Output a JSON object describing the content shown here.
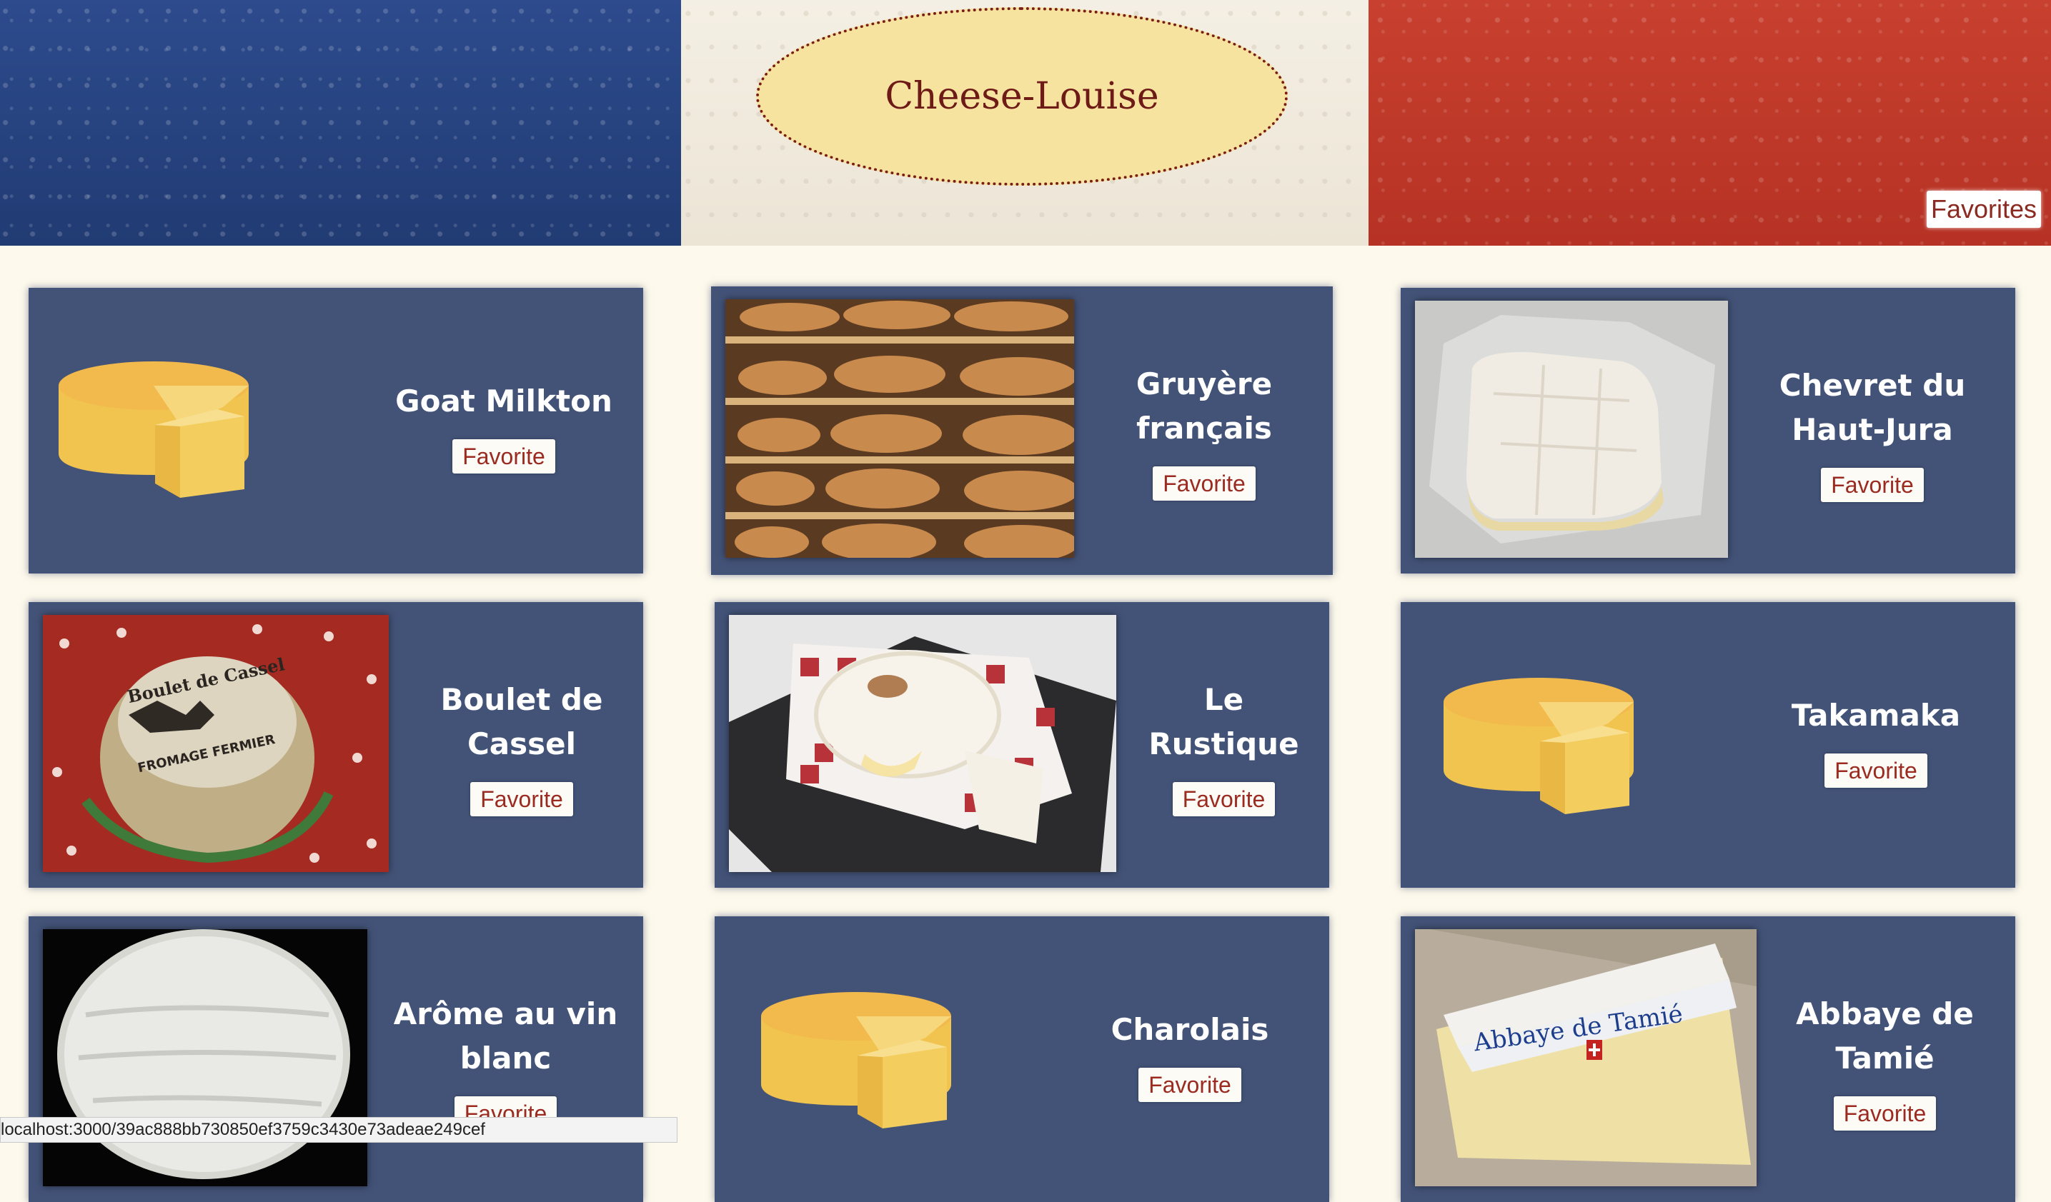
{
  "header": {
    "logo_text": "Cheese-Louise",
    "favorites_link": "Favorites"
  },
  "cards": [
    {
      "name_lines": [
        "Goat Milkton"
      ],
      "button": "Favorite",
      "image": "cheese-wheel-icon"
    },
    {
      "name_lines": [
        "Gruyère",
        "français"
      ],
      "button": "Favorite",
      "image": "gruyere-photo"
    },
    {
      "name_lines": [
        "Chevret du",
        "Haut-Jura"
      ],
      "button": "Favorite",
      "image": "chevret-photo"
    },
    {
      "name_lines": [
        "Boulet de",
        "Cassel"
      ],
      "button": "Favorite",
      "image": "boulet-photo"
    },
    {
      "name_lines": [
        "Le",
        "Rustique"
      ],
      "button": "Favorite",
      "image": "rustique-photo"
    },
    {
      "name_lines": [
        "Takamaka"
      ],
      "button": "Favorite",
      "image": "cheese-wheel-icon"
    },
    {
      "name_lines": [
        "Arôme au vin",
        "blanc"
      ],
      "button": "Favorite",
      "image": "arome-photo"
    },
    {
      "name_lines": [
        "Charolais"
      ],
      "button": "Favorite",
      "image": "cheese-wheel-icon"
    },
    {
      "name_lines": [
        "Abbaye de",
        "Tamié"
      ],
      "button": "Favorite",
      "image": "abbaye-photo"
    }
  ],
  "photo_labels": {
    "boulet": "Boulet de Cassel",
    "boulet_sub": "FROMAGE FERMIER",
    "abbaye": "Abbaye de Tamié"
  },
  "status_url": "localhost:3000/39ac888bb730850ef3759c3430e73adeae249cef",
  "colors": {
    "card_bg": "#435378",
    "page_bg": "#fdf9ec",
    "flag_blue": "#2c4a8a",
    "flag_white": "#f1ece0",
    "flag_red": "#c43a2c",
    "button_text": "#9b2a20",
    "logo_oval": "#f6e3a0"
  }
}
